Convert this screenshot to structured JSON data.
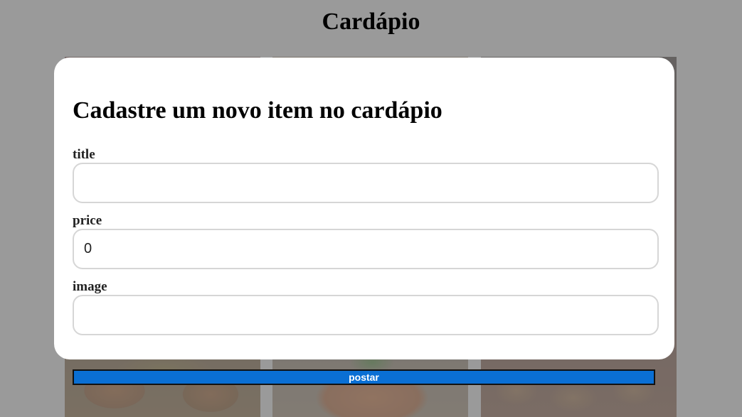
{
  "page": {
    "title": "Cardápio"
  },
  "modal": {
    "title": "Cadastre um novo item no cardápio",
    "fields": [
      {
        "label": "title",
        "value": ""
      },
      {
        "label": "price",
        "value": "0"
      },
      {
        "label": "image",
        "value": ""
      }
    ]
  },
  "submit": {
    "label": "postar",
    "color": "#0a6fd4"
  },
  "overlay_color": "#9a9a9a"
}
